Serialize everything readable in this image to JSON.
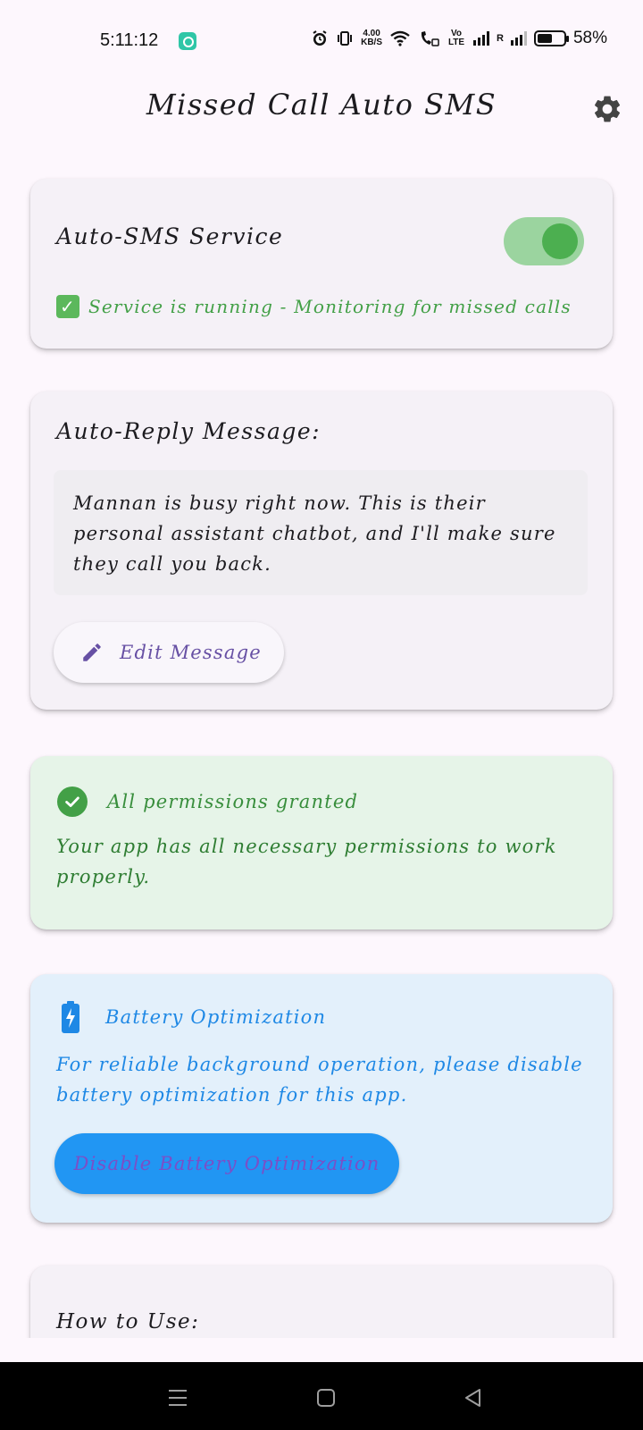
{
  "status_bar": {
    "time": "5:11:12",
    "network_speed_value": "4.00",
    "network_speed_unit": "KB/S",
    "volte_label": "Vo LTE",
    "roaming_label": "R",
    "battery_percent": "58%",
    "battery_level": 0.58,
    "icons": [
      "app-notification-icon",
      "alarm-icon",
      "vibrate-icon",
      "wifi-icon",
      "wifi-call-icon",
      "signal-icon",
      "signal-roaming-icon",
      "battery-icon"
    ]
  },
  "app_bar": {
    "title": "Missed Call Auto SMS",
    "settings_icon": "gear-icon"
  },
  "service_card": {
    "title": "Auto-SMS Service",
    "toggle_on": true,
    "status_text": "Service is running - Monitoring for missed calls",
    "status_icon": "check-box-icon"
  },
  "message_card": {
    "title": "Auto-Reply Message:",
    "message": "Mannan is busy right now. This is their personal assistant chatbot, and I'll make sure they call you back.",
    "edit_button_label": "Edit Message",
    "edit_icon": "pencil-icon"
  },
  "permissions_card": {
    "title": "All permissions granted",
    "text": "Your app has all necessary permissions to work properly.",
    "icon": "check-circle-icon"
  },
  "battery_card": {
    "title": "Battery Optimization",
    "text": "For reliable background operation, please disable battery optimization for this app.",
    "button_label": "Disable Battery Optimization",
    "icon": "battery-charging-icon"
  },
  "howto_card": {
    "title": "How to Use:"
  },
  "nav_bar": {
    "buttons": [
      "menu-icon",
      "home-icon",
      "back-icon"
    ]
  },
  "colors": {
    "background": "#fdf7fd",
    "card": "#f5f1f7",
    "green": "#43a047",
    "green_card": "#e6f4e8",
    "blue": "#1e88e5",
    "blue_card": "#e3f0fb",
    "button_blue": "#2196f3",
    "purple": "#6750a4"
  }
}
